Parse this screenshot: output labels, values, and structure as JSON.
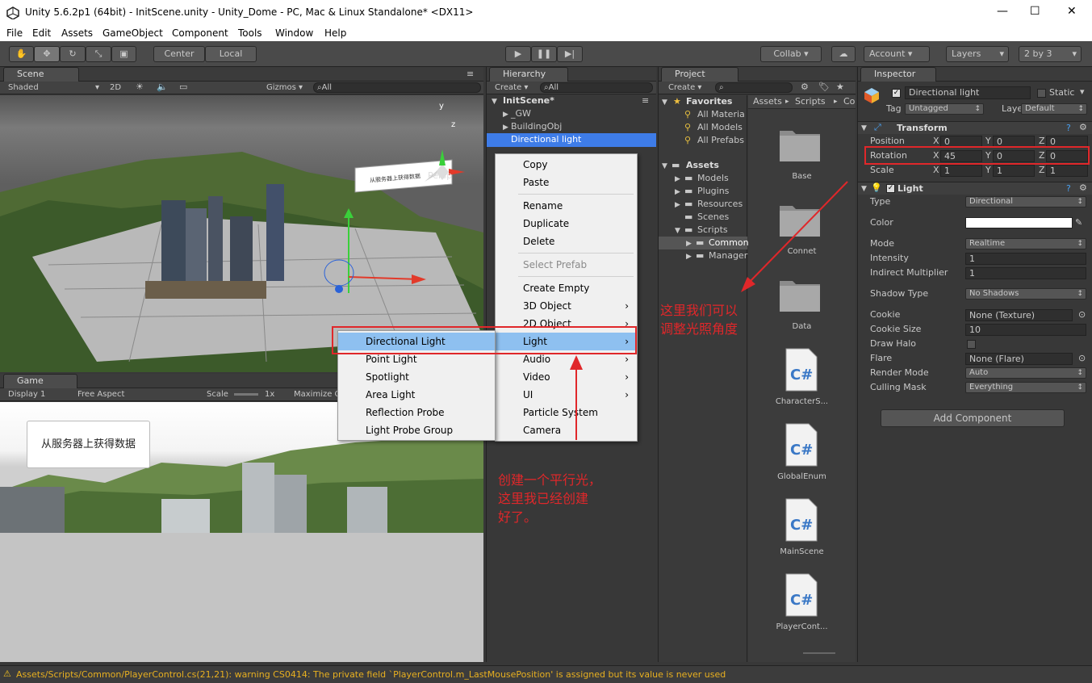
{
  "window": {
    "title": "Unity 5.6.2p1 (64bit) - InitScene.unity - Unity_Dome - PC, Mac & Linux Standalone* <DX11>",
    "minimize": "—",
    "maximize": "☐",
    "close": "✕"
  },
  "menu": [
    "File",
    "Edit",
    "Assets",
    "GameObject",
    "Component",
    "Tools",
    "Window",
    "Help"
  ],
  "toolbar": {
    "center": "Center",
    "local": "Local",
    "collab": "Collab ▾",
    "account": "Account ▾",
    "layers": "Layers",
    "layout": "2 by 3"
  },
  "scene": {
    "tab": "Scene",
    "shading": "Shaded",
    "mode2d": "2D",
    "gizmos": "Gizmos ▾",
    "search_placeholder": "All",
    "persp": "Persp",
    "billboard": "从服务器上获得数据"
  },
  "game": {
    "tab": "Game",
    "display": "Display 1",
    "aspect": "Free Aspect",
    "scale_label": "Scale",
    "scale_value": "1x",
    "maximize": "Maximize O",
    "button": "从服务器上获得数据"
  },
  "hierarchy": {
    "tab": "Hierarchy",
    "create": "Create ▾",
    "search_placeholder": "All",
    "scene_name": "InitScene*",
    "items": [
      "_GW",
      "BuildingObj",
      "Directional light"
    ]
  },
  "context_menu": {
    "items": [
      "Copy",
      "Paste",
      "Rename",
      "Duplicate",
      "Delete",
      "Select Prefab",
      "Create Empty",
      "3D Object",
      "2D Object",
      "Light",
      "Audio",
      "Video",
      "UI",
      "Particle System",
      "Camera"
    ]
  },
  "light_submenu": {
    "items": [
      "Directional Light",
      "Point Light",
      "Spotlight",
      "Area Light",
      "Reflection Probe",
      "Light Probe Group"
    ]
  },
  "project": {
    "tab": "Project",
    "create": "Create ▾",
    "favorites_label": "Favorites",
    "favorites": [
      "All Materia",
      "All Models",
      "All Prefabs"
    ],
    "assets_label": "Assets",
    "assets": [
      "Models",
      "Plugins",
      "Resources",
      "Scenes",
      "Scripts"
    ],
    "scripts_children": [
      "Common",
      "Manager"
    ],
    "breadcrumb": [
      "Assets",
      "Scripts",
      "Co"
    ],
    "files": [
      "Base",
      "Connet",
      "Data",
      "CharacterS...",
      "GlobalEnum",
      "MainScene",
      "PlayerCont..."
    ]
  },
  "inspector": {
    "tab": "Inspector",
    "object_name": "Directional light",
    "static_label": "Static",
    "tag_label": "Tag",
    "tag_value": "Untagged",
    "layer_label": "Layer",
    "layer_value": "Default",
    "transform_label": "Transform",
    "position_label": "Position",
    "position": [
      "0",
      "0",
      "0"
    ],
    "rotation_label": "Rotation",
    "rotation": [
      "45",
      "0",
      "0"
    ],
    "scale_label": "Scale",
    "scale": [
      "1",
      "1",
      "1"
    ],
    "axis_labels": [
      "X",
      "Y",
      "Z"
    ],
    "light_label": "Light",
    "props": [
      {
        "label": "Type",
        "value": "Directional",
        "kind": "drop"
      },
      {
        "label": "Color",
        "value": "",
        "kind": "color"
      },
      {
        "label": "Mode",
        "value": "Realtime",
        "kind": "drop"
      },
      {
        "label": "Intensity",
        "value": "1",
        "kind": "field"
      },
      {
        "label": "Indirect Multiplier",
        "value": "1",
        "kind": "field"
      },
      {
        "label": "Shadow Type",
        "value": "No Shadows",
        "kind": "drop"
      },
      {
        "label": "Cookie",
        "value": "None (Texture)",
        "kind": "obj"
      },
      {
        "label": "Cookie Size",
        "value": "10",
        "kind": "field"
      },
      {
        "label": "Draw Halo",
        "value": "",
        "kind": "check"
      },
      {
        "label": "Flare",
        "value": "None (Flare)",
        "kind": "obj"
      },
      {
        "label": "Render Mode",
        "value": "Auto",
        "kind": "drop"
      },
      {
        "label": "Culling Mask",
        "value": "Everything",
        "kind": "drop"
      }
    ],
    "add_component": "Add Component"
  },
  "status_bar": "Assets/Scripts/Common/PlayerControl.cs(21,21): warning CS0414: The private field `PlayerControl.m_LastMousePosition' is assigned but its value is never used",
  "annotations": {
    "rotation_note": [
      "这里我们可以",
      "调整光照角度"
    ],
    "create_note": [
      "创建一个平行光，",
      "这里我已经创建",
      "好了。"
    ]
  },
  "colors": {
    "accent": "#3e7ce8",
    "annotation": "#e0272a",
    "selection": "#8ec0f0"
  }
}
